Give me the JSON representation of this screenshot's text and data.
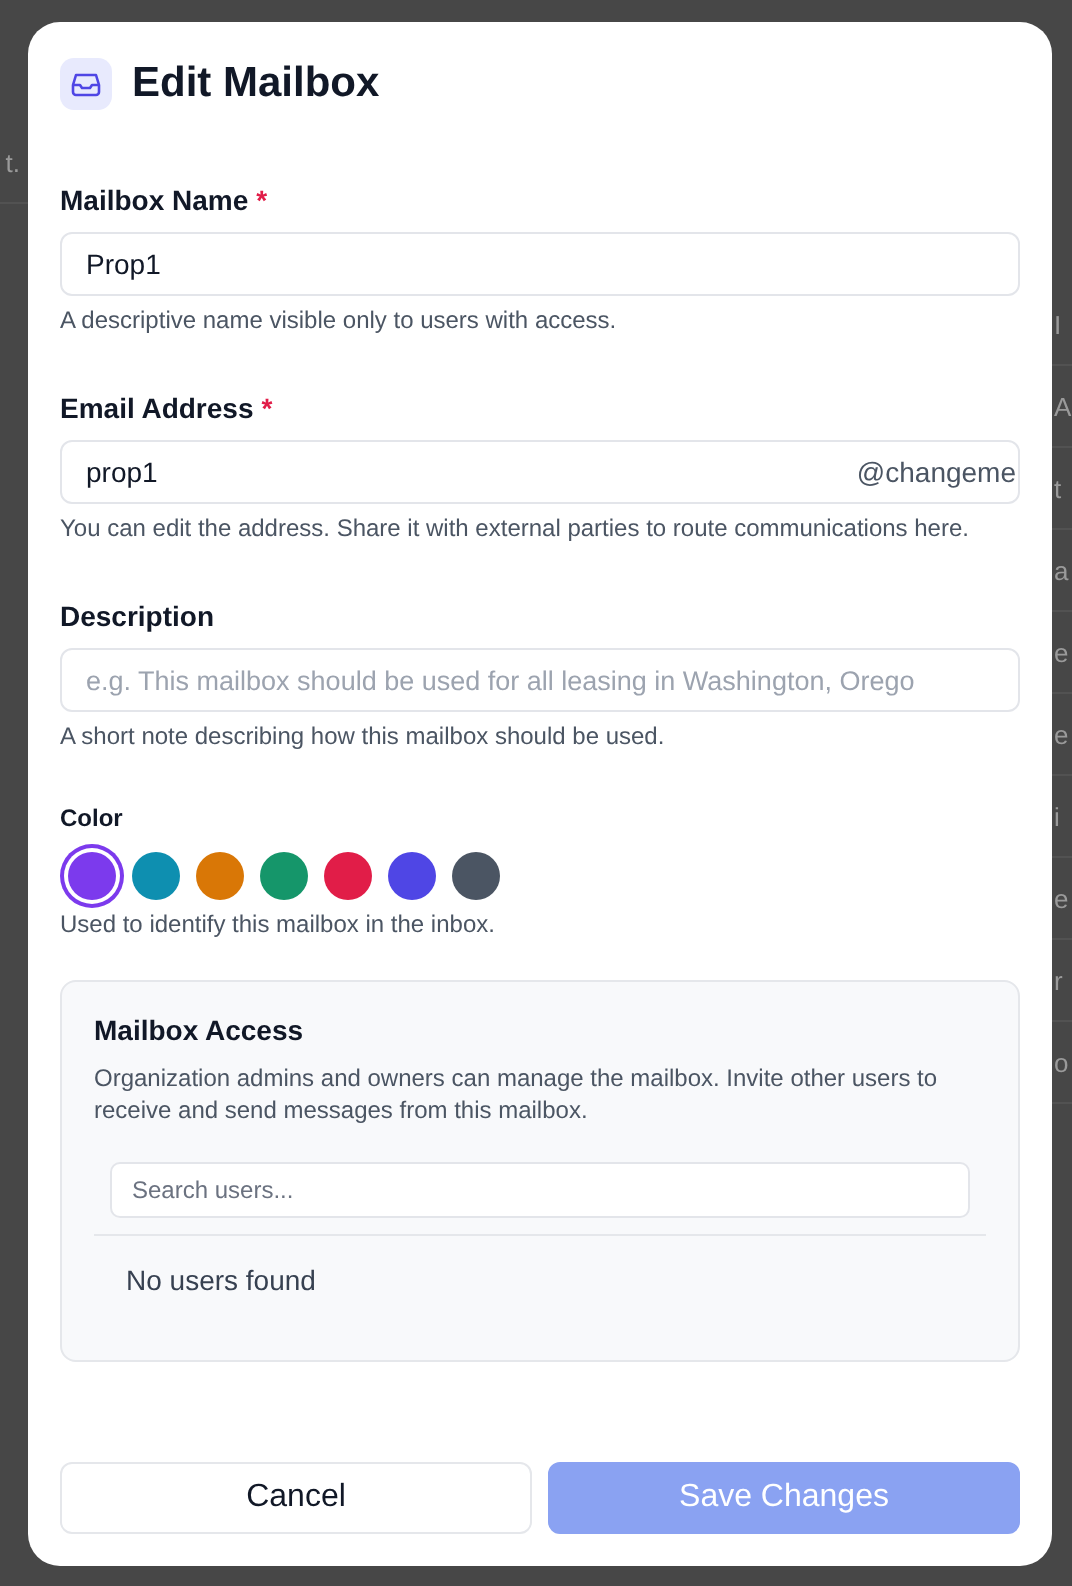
{
  "background": {
    "left_fragments": [
      "t."
    ],
    "right_fragments": [
      "I",
      "A",
      "t",
      "a",
      "e",
      "e",
      "i",
      "e",
      "r",
      "o"
    ]
  },
  "dialog": {
    "title": "Edit Mailbox"
  },
  "fields": [
    {
      "label": "Mailbox Name",
      "required": true,
      "value": "Prop1",
      "help": "A descriptive name visible only to users with access."
    },
    {
      "label": "Email Address",
      "required": true,
      "value": "prop1",
      "suffix": "@changeme",
      "help": "You can edit the address. Share it with external parties to route communications here."
    },
    {
      "label": "Description",
      "required": false,
      "placeholder": "e.g. This mailbox should be used for all leasing in Washington, Orego",
      "help": "A short note describing how this mailbox should be used."
    }
  ],
  "required_mark": "*",
  "color": {
    "label": "Color",
    "help": "Used to identify this mailbox in the inbox.",
    "options": [
      {
        "color": "#7c3aed",
        "selected": true
      },
      {
        "color": "#0e8fb0",
        "selected": false
      },
      {
        "color": "#d97706",
        "selected": false
      },
      {
        "color": "#15966a",
        "selected": false
      },
      {
        "color": "#e11d48",
        "selected": false
      },
      {
        "color": "#4f46e5",
        "selected": false
      },
      {
        "color": "#4b5563",
        "selected": false
      }
    ]
  },
  "access": {
    "title": "Mailbox Access",
    "text": "Organization admins and owners can manage the mailbox. Invite other users to receive and send messages from this mailbox.",
    "search_placeholder": "Search users...",
    "empty": "No users found"
  },
  "buttons": [
    {
      "label": "Cancel",
      "kind": "secondary",
      "disabled": false
    },
    {
      "label": "Save Changes",
      "kind": "primary",
      "disabled": true
    }
  ]
}
